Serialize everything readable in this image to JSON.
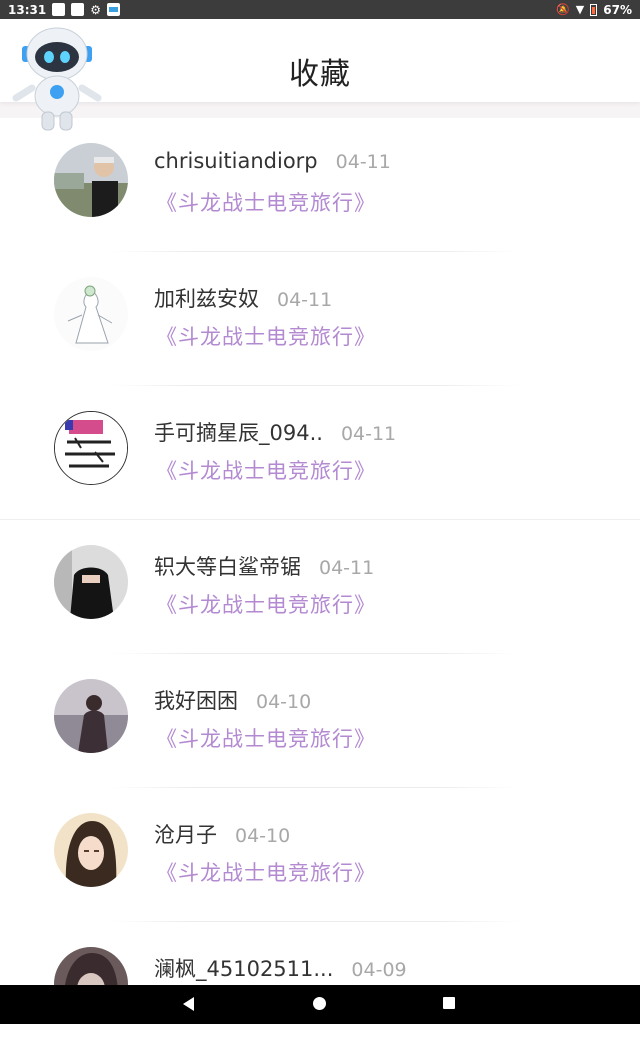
{
  "status_bar": {
    "time": "13:31",
    "battery": "67%"
  },
  "header": {
    "title": "收藏"
  },
  "favorites": [
    {
      "name": "chrisuitiandiorp",
      "date": "04-11",
      "work": "《斗龙战士电竞旅行》",
      "avatar": "avatar-photo-man"
    },
    {
      "name": "加利兹安奴",
      "date": "04-11",
      "work": "《斗龙战士电竞旅行》",
      "avatar": "avatar-drawing-dress"
    },
    {
      "name": "手可摘星辰_094..",
      "date": "04-11",
      "work": "《斗龙战士电竞旅行》",
      "avatar": "avatar-sticker-text"
    },
    {
      "name": "轵大等白鲨帝锯",
      "date": "04-11",
      "work": "《斗龙战士电竞旅行》",
      "avatar": "avatar-photo-dark"
    },
    {
      "name": "我好困困",
      "date": "04-10",
      "work": "《斗龙战士电竞旅行》",
      "avatar": "avatar-photo-girl"
    },
    {
      "name": "沧月子",
      "date": "04-10",
      "work": "《斗龙战士电竞旅行》",
      "avatar": "avatar-anime-girl"
    },
    {
      "name": "澜枫_45102511...",
      "date": "04-09",
      "work": "",
      "avatar": "avatar-anime-dark"
    }
  ],
  "colors": {
    "accent_purple": "#b38ad2",
    "date_gray": "#a8a8a8",
    "status_bar_bg": "#3c3c3c",
    "nav_bar_bg": "#000000"
  },
  "icons": {
    "mascot": "robot-mascot-icon",
    "nav_back": "back-triangle-icon",
    "nav_home": "home-circle-icon",
    "nav_recent": "recent-apps-square-icon"
  }
}
